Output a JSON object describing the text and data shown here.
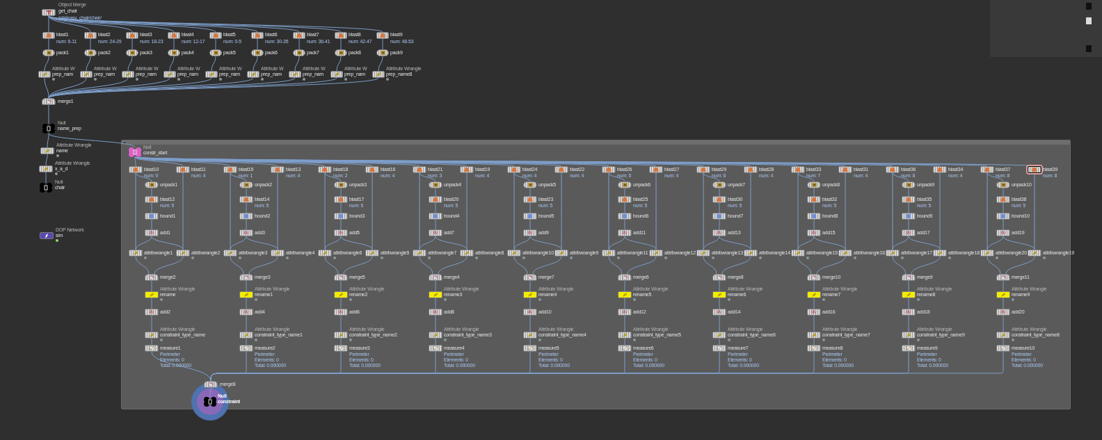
{
  "object_merge": {
    "type_label": "Object Merge",
    "name": "get_chair",
    "path": "/obj/easy_chair/chair/"
  },
  "top_columns": [
    {
      "blast": "blast1",
      "num": "num: 6-11",
      "pack": "pack1",
      "wrangle_type": "Attribute W",
      "wrangle": "prep_nam"
    },
    {
      "blast": "blast2",
      "num": "num: 24-29",
      "pack": "pack2",
      "wrangle_type": "Attribute W",
      "wrangle": "prep_nam"
    },
    {
      "blast": "blast3",
      "num": "num: 18-23",
      "pack": "pack3",
      "wrangle_type": "Attribute W",
      "wrangle": "prep_nam"
    },
    {
      "blast": "blast4",
      "num": "num: 12-17",
      "pack": "pack4",
      "wrangle_type": "Attribute W",
      "wrangle": "prep_nam"
    },
    {
      "blast": "blast5",
      "num": "num: 0-5",
      "pack": "pack5",
      "wrangle_type": "Attribute W",
      "wrangle": "prep_nam"
    },
    {
      "blast": "blast6",
      "num": "num: 30-35",
      "pack": "pack6",
      "wrangle_type": "Attribute W",
      "wrangle": "prep_nam"
    },
    {
      "blast": "blast7",
      "num": "num: 36-41",
      "pack": "pack7",
      "wrangle_type": "Attribute W",
      "wrangle": "prep_nam"
    },
    {
      "blast": "blast8",
      "num": "num: 42-47",
      "pack": "pack8",
      "wrangle_type": "Attribute W",
      "wrangle": "prep_nam"
    },
    {
      "blast": "blast9",
      "num": "num: 48-53",
      "pack": "pack9",
      "wrangle_type": "Attribute Wrangle",
      "wrangle": "prep_name8"
    }
  ],
  "merge_top": "merge1",
  "left_nodes": [
    {
      "kind": "null",
      "type_label": "Null",
      "name": "name_prep",
      "color": "#000000"
    },
    {
      "kind": "wrangle",
      "type_label": "Attribute Wrangle",
      "name": "name"
    },
    {
      "kind": "wrangle",
      "type_label": "Attribute Wrangle",
      "name": "x_a_d"
    },
    {
      "kind": "null",
      "type_label": "Null",
      "name": "chair",
      "color": "#000000"
    },
    {
      "kind": "dop",
      "type_label": "DOP Network",
      "name": "sim"
    }
  ],
  "network_box": {
    "start": {
      "type_label": "Null",
      "name": "constr_start",
      "color": "#e060c8"
    },
    "columns": [
      {
        "left": {
          "name": "blast10",
          "num": "num: 0"
        },
        "right": {
          "name": "blast11",
          "num": "num: 4",
          "selected": false
        },
        "unpack": "unpack1",
        "inner_blast": {
          "name": "blast12",
          "num": "num: 5"
        },
        "bound": "bound1",
        "add_a": "add1",
        "wrangle_a": "attribwrangle1",
        "wrangle_b": "attribwrangle2",
        "merge": "merge2",
        "rename": {
          "type_label": "Attribute Wrangle",
          "name": "rename",
          "bypassed": true
        },
        "add_b": "add2",
        "constraint": {
          "type_label": "Attribute Wrangle",
          "name": "constraint_type_name"
        },
        "measure": {
          "name": "measure1",
          "lines": [
            "Perimeter",
            "Elements: 0",
            "Total: 0.000000"
          ]
        }
      },
      {
        "left": {
          "name": "blast15",
          "num": "num: 1"
        },
        "right": {
          "name": "blast13",
          "num": "num: 4",
          "selected": false
        },
        "unpack": "unpack2",
        "inner_blast": {
          "name": "blast14",
          "num": "num: 5"
        },
        "bound": "bound2",
        "add_a": "add3",
        "wrangle_a": "attribwrangle3",
        "wrangle_b": "attribwrangle4",
        "merge": "merge3",
        "rename": {
          "type_label": "Attribute Wrangle",
          "name": "rename1",
          "bypassed": true
        },
        "add_b": "add4",
        "constraint": {
          "type_label": "Attribute Wrangle",
          "name": "constraint_type_name1"
        },
        "measure": {
          "name": "measure2",
          "lines": [
            "Perimeter",
            "Elements: 0",
            "Total: 0.000000"
          ]
        }
      },
      {
        "left": {
          "name": "blast18",
          "num": "num: 2"
        },
        "right": {
          "name": "blast16",
          "num": "num: 4",
          "selected": false
        },
        "unpack": "unpack3",
        "inner_blast": {
          "name": "blast17",
          "num": "num: 5"
        },
        "bound": "bound3",
        "add_a": "add5",
        "wrangle_a": "attribwrangle6",
        "wrangle_b": "attribwrangle5",
        "merge": "merge5",
        "rename": {
          "type_label": "Attribute Wrangle",
          "name": "rename2",
          "bypassed": true
        },
        "add_b": "add6",
        "constraint": {
          "type_label": "Attribute Wrangle",
          "name": "constraint_type_name2"
        },
        "measure": {
          "name": "measure3",
          "lines": [
            "Perimeter",
            "Elements: 0",
            "Total: 0.000000"
          ]
        }
      },
      {
        "left": {
          "name": "blast21",
          "num": "num: 3"
        },
        "right": {
          "name": "blast19",
          "num": "num: 4",
          "selected": false
        },
        "unpack": "unpack4",
        "inner_blast": {
          "name": "blast20",
          "num": "num: 5"
        },
        "bound": "bound4",
        "add_a": "add7",
        "wrangle_a": "attribwrangle7",
        "wrangle_b": "attribwrangle8",
        "merge": "merge4",
        "rename": {
          "type_label": "Attribute Wrangle",
          "name": "rename3",
          "bypassed": true
        },
        "add_b": "add8",
        "constraint": {
          "type_label": "Attribute Wrangle",
          "name": "constraint_type_name3"
        },
        "measure": {
          "name": "measure4",
          "lines": [
            "Perimeter",
            "Elements: 0",
            "Total: 0.000000"
          ]
        }
      },
      {
        "left": {
          "name": "blast24",
          "num": "num: 4"
        },
        "right": {
          "name": "blast22",
          "num": "num: 4",
          "selected": false
        },
        "unpack": "unpack5",
        "inner_blast": {
          "name": "blast23",
          "num": "num: 5"
        },
        "bound": "bound5",
        "add_a": "add9",
        "wrangle_a": "attribwrangle10",
        "wrangle_b": "attribwrangle9",
        "merge": "merge7",
        "rename": {
          "type_label": "Attribute Wrangle",
          "name": "rename4",
          "bypassed": true
        },
        "add_b": "add10",
        "constraint": {
          "type_label": "Attribute Wrangle",
          "name": "constraint_type_name4"
        },
        "measure": {
          "name": "measure5",
          "lines": [
            "Perimeter",
            "Elements: 0",
            "Total: 0.000000"
          ]
        }
      },
      {
        "left": {
          "name": "blast26",
          "num": "num: 5"
        },
        "right": {
          "name": "blast27",
          "num": "num: 4",
          "selected": false
        },
        "unpack": "unpack6",
        "inner_blast": {
          "name": "blast25",
          "num": "num: 5"
        },
        "bound": "bound6",
        "add_a": "add11",
        "wrangle_a": "attribwrangle11",
        "wrangle_b": "attribwrangle12",
        "merge": "merge6",
        "rename": {
          "type_label": "Attribute Wrangle",
          "name": "rename5",
          "bypassed": true
        },
        "add_b": "add12",
        "constraint": {
          "type_label": "Attribute Wrangle",
          "name": "constraint_type_name5"
        },
        "measure": {
          "name": "measure6",
          "lines": [
            "Perimeter",
            "Elements: 0",
            "Total: 0.000000"
          ]
        }
      },
      {
        "left": {
          "name": "blast29",
          "num": "num: 6"
        },
        "right": {
          "name": "blast28",
          "num": "num: 4",
          "selected": false
        },
        "unpack": "unpack7",
        "inner_blast": {
          "name": "blast30",
          "num": "num: 5"
        },
        "bound": "bound7",
        "add_a": "add13",
        "wrangle_a": "attribwrangle13",
        "wrangle_b": "attribwrangle14",
        "merge": "merge8",
        "rename": {
          "type_label": "Attribute Wrangle",
          "name": "rename6",
          "bypassed": true
        },
        "add_b": "add14",
        "constraint": {
          "type_label": "Attribute Wrangle",
          "name": "constraint_type_name6"
        },
        "measure": {
          "name": "measure7",
          "lines": [
            "Perimeter",
            "Elements: 0",
            "Total: 0.000000"
          ]
        }
      },
      {
        "left": {
          "name": "blast33",
          "num": "num: 7"
        },
        "right": {
          "name": "blast31",
          "num": "num: 4",
          "selected": false
        },
        "unpack": "unpack8",
        "inner_blast": {
          "name": "blast32",
          "num": "num: 5"
        },
        "bound": "bound8",
        "add_a": "add15",
        "wrangle_a": "attribwrangle15",
        "wrangle_b": "attribwrangle16",
        "merge": "merge10",
        "rename": {
          "type_label": "Attribute Wrangle",
          "name": "rename7",
          "bypassed": true
        },
        "add_b": "add16",
        "constraint": {
          "type_label": "Attribute Wrangle",
          "name": "constraint_type_name7"
        },
        "measure": {
          "name": "measure8",
          "lines": [
            "Perimeter",
            "Elements: 0",
            "Total: 0.000000"
          ]
        }
      },
      {
        "left": {
          "name": "blast36",
          "num": "num: 8"
        },
        "right": {
          "name": "blast34",
          "num": "num: 4",
          "selected": false
        },
        "unpack": "unpack9",
        "inner_blast": {
          "name": "blast35",
          "num": "num: 5"
        },
        "bound": "bound9",
        "add_a": "add17",
        "wrangle_a": "attribwrangle17",
        "wrangle_b": "attribwrangle18",
        "merge": "merge9",
        "rename": {
          "type_label": "Attribute Wrangle",
          "name": "rename8",
          "bypassed": true
        },
        "add_b": "add18",
        "constraint": {
          "type_label": "Attribute Wrangle",
          "name": "constraint_type_name9"
        },
        "measure": {
          "name": "measure9",
          "lines": [
            "Perimeter",
            "Elements: 0",
            "Total: 0.000000"
          ]
        }
      },
      {
        "left": {
          "name": "blast37",
          "num": "num: 8"
        },
        "right": {
          "name": "blast39",
          "num": "num: 8",
          "selected": true
        },
        "unpack": "unpack10",
        "inner_blast": {
          "name": "blast38",
          "num": "num: 5"
        },
        "bound": "bound10",
        "add_a": "add19",
        "wrangle_a": "attribwrangle20",
        "wrangle_b": "attribwrangle19",
        "merge": "merge11",
        "rename": {
          "type_label": "Attribute Wrangle",
          "name": "rename9",
          "bypassed": true
        },
        "add_b": "add20",
        "constraint": {
          "type_label": "Attribute Wrangle",
          "name": "constraint_type_name8"
        },
        "measure": {
          "name": "measure10",
          "lines": [
            "Perimeter",
            "Elements: 0",
            "Total: 0.000000"
          ]
        }
      }
    ]
  },
  "merge_bottom": "merge8",
  "output": {
    "type_label": "Null",
    "name": "constraint",
    "color": "#000000"
  }
}
